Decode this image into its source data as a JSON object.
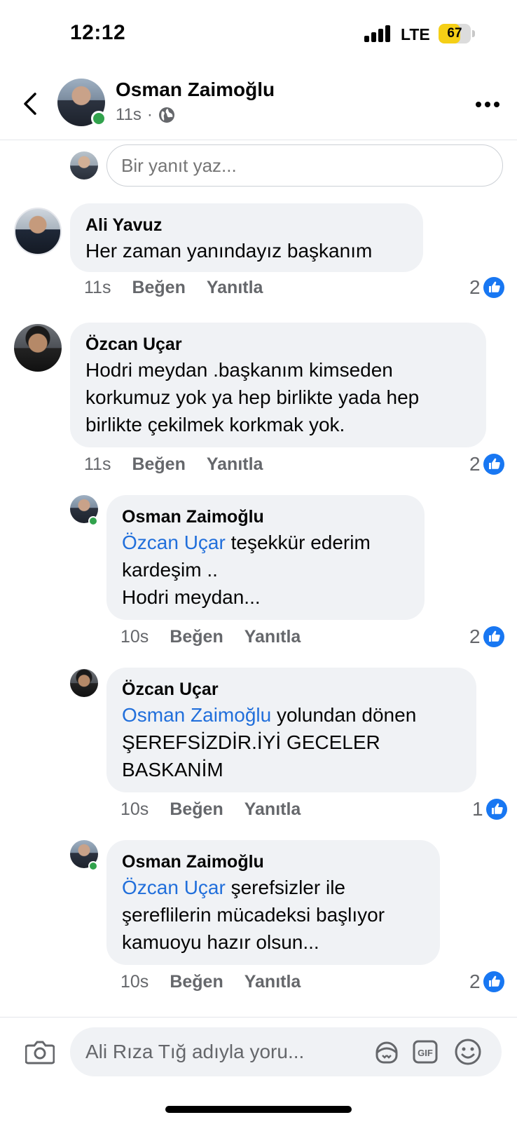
{
  "status_bar": {
    "time": "12:12",
    "network": "LTE",
    "battery": "67",
    "battery_level": 0.67
  },
  "header": {
    "name": "Osman Zaimoğlu",
    "time": "11s",
    "separator": "·",
    "privacy_icon": "globe-icon",
    "back_icon": "chevron-left-icon",
    "more_icon": "more-horizontal-icon"
  },
  "reply": {
    "placeholder": "Bir yanıt yaz..."
  },
  "comments": [
    {
      "author": "Ali Yavuz",
      "lines": [
        "Her zaman yanındayız başkanım"
      ],
      "time": "11s",
      "like": "Beğen",
      "reply": "Yanıtla",
      "reactions": "2"
    },
    {
      "author": "Özcan Uçar",
      "lines": [
        "Hodri meydan .başkanım kimseden",
        "korkumuz yok ya hep birlikte yada hep",
        "birlikte çekilmek korkmak yok."
      ],
      "time": "11s",
      "like": "Beğen",
      "reply": "Yanıtla",
      "reactions": "2"
    },
    {
      "author": "Osman Zaimoğlu",
      "mention": "Özcan Uçar",
      "lines": [
        " teşekkür ederim",
        "kardeşim ..",
        "Hodri meydan..."
      ],
      "time": "10s",
      "like": "Beğen",
      "reply": "Yanıtla",
      "reactions": "2"
    },
    {
      "author": "Özcan Uçar",
      "mention": "Osman Zaimoğlu",
      "lines": [
        " yolundan dönen",
        "ŞEREFSİZDİR.İYİ GECELER",
        "BASKANİM"
      ],
      "time": "10s",
      "like": "Beğen",
      "reply": "Yanıtla",
      "reactions": "1"
    },
    {
      "author": "Osman Zaimoğlu",
      "mention": "Özcan Uçar",
      "lines": [
        " şerefsizler ile",
        "şereflilerin mücadeksi başlıyor",
        "kamuoyu hazır olsun..."
      ],
      "time": "10s",
      "like": "Beğen",
      "reply": "Yanıtla",
      "reactions": "2"
    }
  ],
  "composer": {
    "placeholder": "Ali Rıza Tığ adıyla yoru...",
    "icons": [
      "camera-icon",
      "avatar-sticker-icon",
      "gif-icon",
      "emoji-icon"
    ]
  },
  "colors": {
    "mention": "#216fdb",
    "like_blue": "#1877f2",
    "online": "#31a24c",
    "bubble": "#f0f2f5",
    "battery": "#f5cf16"
  }
}
